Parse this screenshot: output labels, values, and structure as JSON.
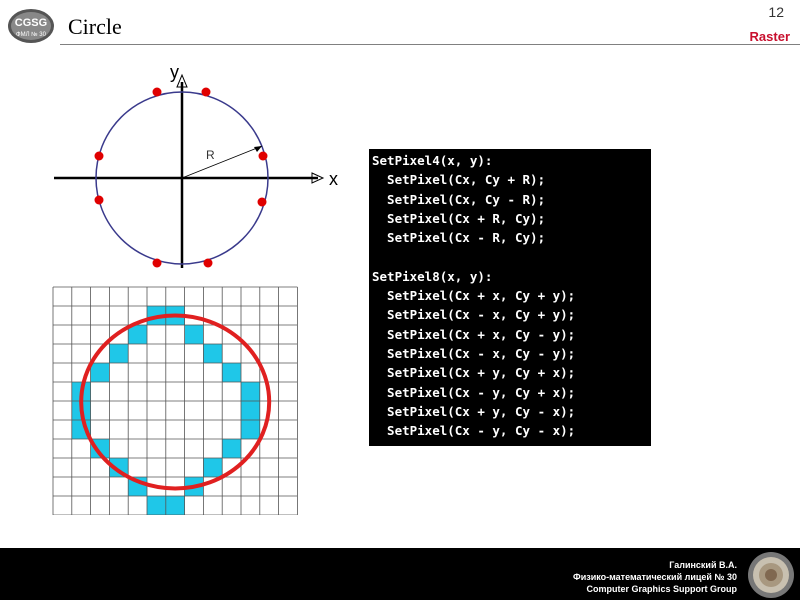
{
  "header": {
    "logo_text_top": "CGSG",
    "logo_text_bottom": "ФМЛ № 30",
    "title": "Circle",
    "slide_number": "12",
    "section": "Raster"
  },
  "diagram": {
    "x_label": "x",
    "y_label": "y",
    "radius_label": "R"
  },
  "grid": {
    "cols": 13,
    "rows": 12,
    "highlight_color": "#1fc7e8",
    "circle_color": "#e02020",
    "filled_cells": [
      [
        1,
        5
      ],
      [
        1,
        6
      ],
      [
        2,
        4
      ],
      [
        2,
        7
      ],
      [
        3,
        3
      ],
      [
        3,
        8
      ],
      [
        4,
        2
      ],
      [
        4,
        9
      ],
      [
        5,
        1
      ],
      [
        5,
        10
      ],
      [
        6,
        1
      ],
      [
        6,
        10
      ],
      [
        7,
        1
      ],
      [
        7,
        10
      ],
      [
        8,
        2
      ],
      [
        8,
        9
      ],
      [
        9,
        3
      ],
      [
        9,
        8
      ],
      [
        10,
        4
      ],
      [
        10,
        7
      ],
      [
        11,
        5
      ],
      [
        11,
        6
      ]
    ]
  },
  "code": {
    "lines": [
      "SetPixel4(x, y):",
      "  SetPixel(Cx, Cy + R);",
      "  SetPixel(Cx, Cy - R);",
      "  SetPixel(Cx + R, Cy);",
      "  SetPixel(Cx - R, Cy);",
      "",
      "SetPixel8(x, y):",
      "  SetPixel(Cx + x, Cy + y);",
      "  SetPixel(Cx - x, Cy + y);",
      "  SetPixel(Cx + x, Cy - y);",
      "  SetPixel(Cx - x, Cy - y);",
      "  SetPixel(Cx + y, Cy + x);",
      "  SetPixel(Cx - y, Cy + x);",
      "  SetPixel(Cx + y, Cy - x);",
      "  SetPixel(Cx - y, Cy - x);"
    ]
  },
  "footer": {
    "author": "Галинский В.А.",
    "school": "Физико-математический лицей № 30",
    "group": "Computer Graphics Support Group"
  }
}
